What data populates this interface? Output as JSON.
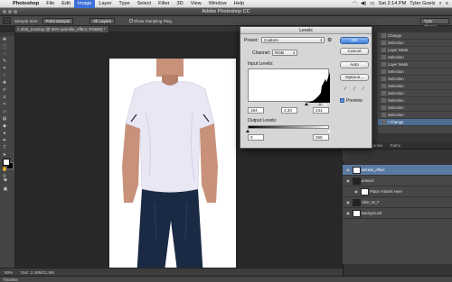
{
  "menubar": {
    "items": [
      "Photoshop",
      "File",
      "Edit",
      "Image",
      "Layer",
      "Type",
      "Select",
      "Filter",
      "3D",
      "View",
      "Window",
      "Help"
    ],
    "clock": "Sat 2:14 PM",
    "user": "Tyler Goelz"
  },
  "app": {
    "title": "Adobe Photoshop CC"
  },
  "options": {
    "sample_size_label": "Sample Size:",
    "sample_size_value": "Point Sample",
    "sample_layers_value": "All Layers",
    "show_ring_label": "Show Sampling Ring",
    "workspace": "Tyler (Basic)"
  },
  "document": {
    "tab": "shirt_mockup @ 50% (wrinkle_effect, RGB/8) *"
  },
  "status": {
    "zoom": "50%",
    "doc": "Doc: 2.40M/11.5M"
  },
  "timeline": {
    "label": "Timeline"
  },
  "history": {
    "items": [
      {
        "label": "Change"
      },
      {
        "label": "Selection"
      },
      {
        "label": "Layer Mask"
      },
      {
        "label": "Selection"
      },
      {
        "label": "Layer Mask"
      },
      {
        "label": "Selection"
      },
      {
        "label": "Selection"
      },
      {
        "label": "Selection"
      },
      {
        "label": "Selection"
      },
      {
        "label": "Selection"
      },
      {
        "label": "Selection"
      },
      {
        "label": "Selection"
      },
      {
        "label": "I Change"
      }
    ]
  },
  "panel_tabs": [
    "Layers",
    "Channels",
    "Paths"
  ],
  "layers": [
    {
      "name": "wrinkle_effect",
      "selected": true,
      "thumb": "white",
      "indent": false
    },
    {
      "name": "artwork",
      "selected": false,
      "thumb": "dark",
      "indent": false
    },
    {
      "name": "Place Artwork Here",
      "selected": false,
      "thumb": "white",
      "indent": true
    },
    {
      "name": "Shirt_W_F",
      "selected": false,
      "thumb": "dark",
      "indent": false
    },
    {
      "name": "Background",
      "selected": false,
      "thumb": "white",
      "indent": false
    }
  ],
  "levels": {
    "title": "Levels",
    "preset_label": "Preset:",
    "preset_value": "Custom",
    "channel_label": "Channel:",
    "channel_value": "RGB",
    "input_label": "Input Levels:",
    "input_black": "184",
    "input_gamma": "2.20",
    "input_white": "244",
    "output_label": "Output Levels:",
    "output_black": "0",
    "output_white": "255",
    "ok": "OK",
    "cancel": "Cancel",
    "auto": "Auto",
    "options": "Options...",
    "preview_label": "Preview",
    "preview_checked": true,
    "input_black_level": 184,
    "input_gamma_level": 2.2,
    "input_white_level": 244,
    "output_black_level": 0,
    "output_white_level": 255
  },
  "colors": {
    "shirt": "#eae7f5",
    "jeans": "#1b2a44",
    "skin": "#c7917a",
    "selected_layer": "#5b7aa1",
    "ok_button": "#3f7fd8"
  }
}
